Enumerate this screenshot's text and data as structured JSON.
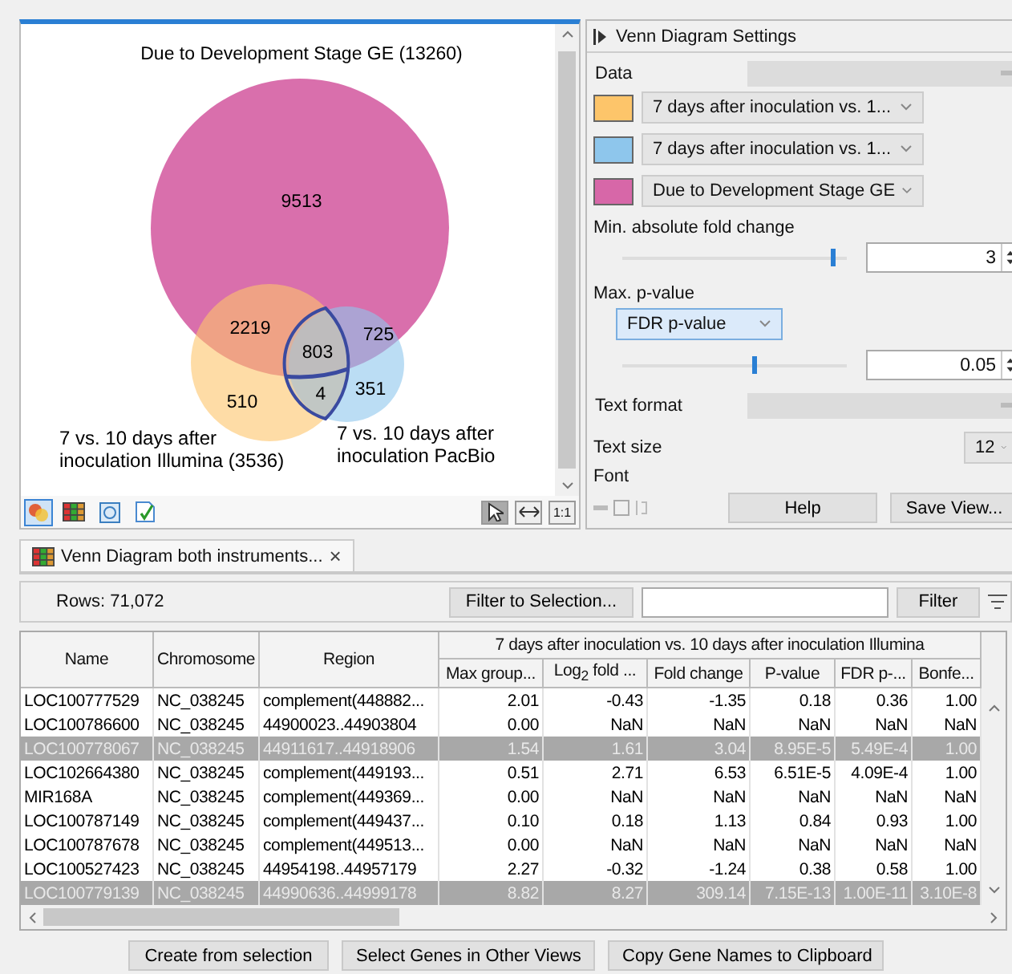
{
  "venn": {
    "title": "Due to Development Stage GE (13260)",
    "regions": [
      {
        "kind": "magenta",
        "text": "9513"
      },
      {
        "kind": "orange_magenta",
        "text": "2219"
      },
      {
        "kind": "all",
        "text": "803"
      },
      {
        "kind": "blue_magenta",
        "text": "725"
      },
      {
        "kind": "orange",
        "text": "510"
      },
      {
        "kind": "orange_blue",
        "text": "4"
      },
      {
        "kind": "blue",
        "text": "351"
      }
    ],
    "set_labels": [
      {
        "lines": [
          "7 vs. 10 days after",
          "inoculation Illumina (3536)"
        ]
      },
      {
        "lines": [
          "7 vs. 10 days after",
          "inoculation PacBio"
        ]
      }
    ],
    "view_buttons": [
      {
        "kind": "venn",
        "selected": true
      },
      {
        "kind": "table",
        "selected": false
      },
      {
        "kind": "history",
        "selected": false
      },
      {
        "kind": "check",
        "selected": false
      }
    ],
    "zoom_tools": [
      {
        "kind": "pointer",
        "selected": true
      },
      {
        "kind": "fit",
        "selected": false
      },
      {
        "kind": "actual",
        "text": "1:1",
        "selected": false
      }
    ]
  },
  "settings": {
    "title": "Venn Diagram Settings",
    "data_tab": "Data",
    "sets": [
      {
        "color": "#fdc56a",
        "value": "7 days after inoculation vs. 1..."
      },
      {
        "color": "#8ec6ec",
        "value": "7 days after inoculation vs. 1..."
      },
      {
        "color": "#d767a8",
        "value": "Due to Development Stage GE"
      }
    ],
    "fold_label": "Min. absolute fold change",
    "fold_slider": {
      "level": 0.93
    },
    "fold_value": "3",
    "p_label": "Max. p-value",
    "p_type": "FDR p-value",
    "p_slider": {
      "level": 0.58
    },
    "p_value": "0.05",
    "text_tab": "Text format",
    "text_size_label": "Text size",
    "text_size": "12",
    "font_label": "Font",
    "buttons": [
      "Help",
      "Save View..."
    ]
  },
  "table_tab": {
    "title": "Venn Diagram both instruments...",
    "close": "×"
  },
  "toolbar": {
    "rows": "Rows: 71,072",
    "filter_selection": "Filter to Selection...",
    "filter": "Filter"
  },
  "table": {
    "columns": [
      "Name",
      "Chromosome",
      "Region"
    ],
    "group": "7 days after inoculation vs. 10 days after inoculation Illumina",
    "subcolumns": [
      "Max group...",
      "Log$_{2}$ fold ...",
      "Fold change",
      "P-value",
      "FDR p-...",
      "Bonfe..."
    ],
    "rows": [
      {
        "selected": false,
        "cells": [
          "LOC100777529",
          "NC_038245",
          "complement(448882...",
          "2.01",
          "-0.43",
          "-1.35",
          "0.18",
          "0.36",
          "1.00"
        ]
      },
      {
        "selected": false,
        "cells": [
          "LOC100786600",
          "NC_038245",
          "44900023..44903804",
          "0.00",
          "NaN",
          "NaN",
          "NaN",
          "NaN",
          "NaN"
        ]
      },
      {
        "selected": true,
        "cells": [
          "LOC100778067",
          "NC_038245",
          "44911617..44918906",
          "1.54",
          "1.61",
          "3.04",
          "8.95E-5",
          "5.49E-4",
          "1.00"
        ]
      },
      {
        "selected": false,
        "cells": [
          "LOC102664380",
          "NC_038245",
          "complement(449193...",
          "0.51",
          "2.71",
          "6.53",
          "6.51E-5",
          "4.09E-4",
          "1.00"
        ]
      },
      {
        "selected": false,
        "cells": [
          "MIR168A",
          "NC_038245",
          "complement(449369...",
          "0.00",
          "NaN",
          "NaN",
          "NaN",
          "NaN",
          "NaN"
        ]
      },
      {
        "selected": false,
        "cells": [
          "LOC100787149",
          "NC_038245",
          "complement(449437...",
          "0.10",
          "0.18",
          "1.13",
          "0.84",
          "0.93",
          "1.00"
        ]
      },
      {
        "selected": false,
        "cells": [
          "LOC100787678",
          "NC_038245",
          "complement(449513...",
          "0.00",
          "NaN",
          "NaN",
          "NaN",
          "NaN",
          "NaN"
        ]
      },
      {
        "selected": false,
        "cells": [
          "LOC100527423",
          "NC_038245",
          "44954198..44957179",
          "2.27",
          "-0.32",
          "-1.24",
          "0.38",
          "0.58",
          "1.00"
        ]
      },
      {
        "selected": true,
        "cells": [
          "LOC100779139",
          "NC_038245",
          "44990636..44999178",
          "8.82",
          "8.27",
          "309.14",
          "7.15E-13",
          "1.00E-11",
          "3.10E-8"
        ]
      }
    ]
  },
  "actions": [
    "Create from selection",
    "Select Genes in Other Views",
    "Copy Gene Names to Clipboard"
  ]
}
